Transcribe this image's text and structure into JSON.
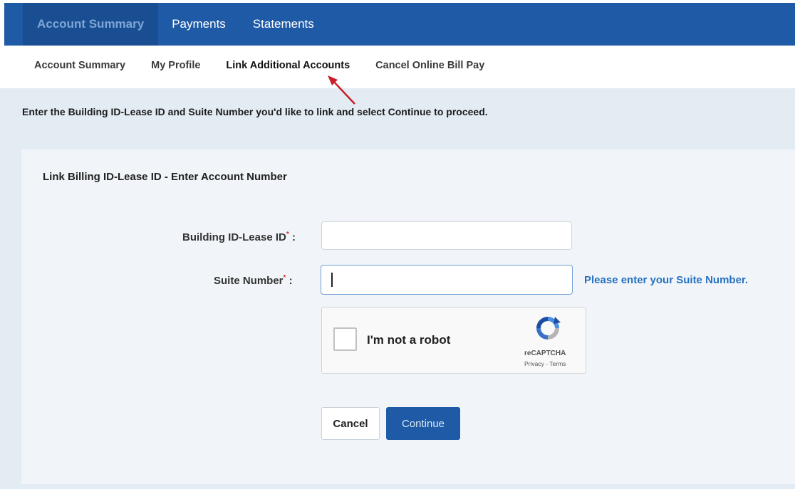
{
  "top_nav": {
    "tabs": [
      {
        "label": "Account Summary",
        "active": true
      },
      {
        "label": "Payments",
        "active": false
      },
      {
        "label": "Statements",
        "active": false
      }
    ]
  },
  "sub_nav": {
    "links": [
      {
        "label": "Account Summary"
      },
      {
        "label": "My Profile"
      },
      {
        "label": "Link Additional Accounts",
        "current": true
      },
      {
        "label": "Cancel Online Bill Pay"
      }
    ]
  },
  "instructions": "Enter the Building ID-Lease ID and Suite Number you'd like to link and select Continue to proceed.",
  "form": {
    "title": "Link Billing ID-Lease ID - Enter Account Number",
    "building_field": {
      "label": "Building ID-Lease ID",
      "required_mark": "*",
      "colon": ":",
      "value": ""
    },
    "suite_field": {
      "label": "Suite Number",
      "required_mark": "*",
      "colon": ":",
      "value": "",
      "help": "Please enter your Suite Number."
    },
    "recaptcha": {
      "label": "I'm not a robot",
      "brand": "reCAPTCHA",
      "links": "Privacy - Terms",
      "checked": false
    },
    "buttons": {
      "cancel": "Cancel",
      "continue": "Continue"
    }
  },
  "colors": {
    "nav_blue": "#1f5aa6",
    "active_tab_text": "#7ea6d6",
    "help_blue": "#2670c0",
    "required_red": "#d0342c",
    "annotation_arrow": "#c8202a"
  },
  "icons": {
    "recaptcha_logo": "recaptcha-logo-icon",
    "annotation": "annotation-arrow-icon"
  }
}
